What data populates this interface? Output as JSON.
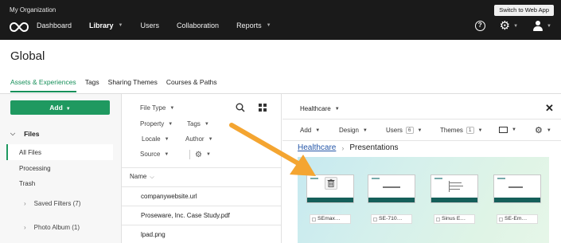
{
  "org": {
    "name": "My Organization",
    "switch_label": "Switch to Web App"
  },
  "nav": {
    "items": [
      {
        "label": "Dashboard",
        "has_caret": false
      },
      {
        "label": "Library",
        "has_caret": true,
        "active": true
      },
      {
        "label": "Users",
        "has_caret": false
      },
      {
        "label": "Collaboration",
        "has_caret": false
      },
      {
        "label": "Reports",
        "has_caret": true
      }
    ],
    "icons": [
      "help-icon",
      "gear-icon",
      "user-icon"
    ]
  },
  "page": {
    "title": "Global"
  },
  "tabs": [
    "Assets & Experiences",
    "Tags",
    "Sharing Themes",
    "Courses & Paths"
  ],
  "sidebar": {
    "add_label": "Add",
    "section_label": "Files",
    "items": [
      "All Files",
      "Processing",
      "Trash"
    ],
    "saved": [
      "Saved Filters (7)",
      "Photo Album (1)"
    ]
  },
  "filters": {
    "items": [
      "File Type",
      "Property",
      "Tags",
      "Locale",
      "Author",
      "Source"
    ]
  },
  "file_list": {
    "column_header": "Name",
    "rows": [
      "companywebsite.url",
      "Proseware, Inc. Case Study.pdf",
      "lpad.png"
    ]
  },
  "detail": {
    "title": "Healthcare",
    "toolbar": {
      "add": "Add",
      "design": "Design",
      "users": "Users",
      "users_count": "6",
      "themes": "Themes",
      "themes_count": "1"
    },
    "breadcrumb": {
      "parent": "Healthcare",
      "current": "Presentations"
    },
    "slides": [
      "SEmax…",
      "SE-710…",
      "Sinus E…",
      "SE-Em…"
    ]
  },
  "colors": {
    "accent": "#1f9960",
    "topbar": "#1a1a1a",
    "arrow": "#f4a531",
    "link": "#2456a8"
  }
}
